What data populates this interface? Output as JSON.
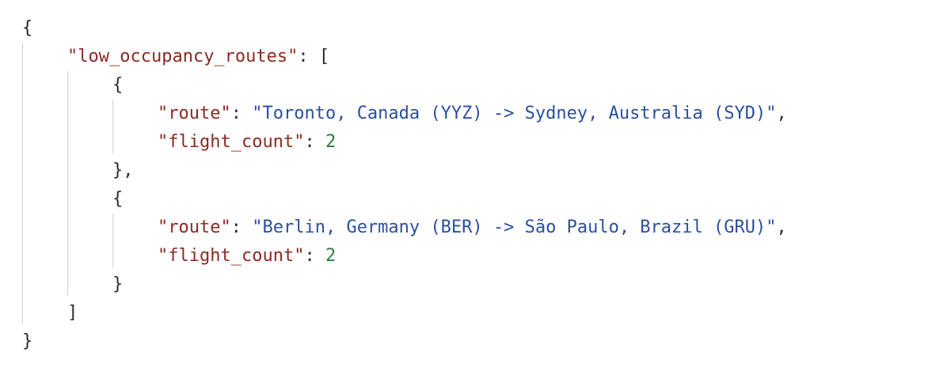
{
  "json_view": {
    "open_root": "{",
    "close_root": "}",
    "open_array": "[",
    "close_array": "]",
    "open_obj": "{",
    "close_obj_comma": "},",
    "close_obj": "}",
    "q": "\"",
    "colon": ": ",
    "comma": ",",
    "top_key": "low_occupancy_routes",
    "items": [
      {
        "route_key": "route",
        "route_value": "Toronto, Canada (YYZ) -> Sydney, Australia (SYD)",
        "count_key": "flight_count",
        "count_value": "2"
      },
      {
        "route_key": "route",
        "route_value": "Berlin, Germany (BER) -> São Paulo, Brazil (GRU)",
        "count_key": "flight_count",
        "count_value": "2"
      }
    ]
  },
  "colors": {
    "key": "#8b2a22",
    "string": "#2b4f9e",
    "number": "#2f7a45",
    "guide": "#d0d0d0"
  }
}
